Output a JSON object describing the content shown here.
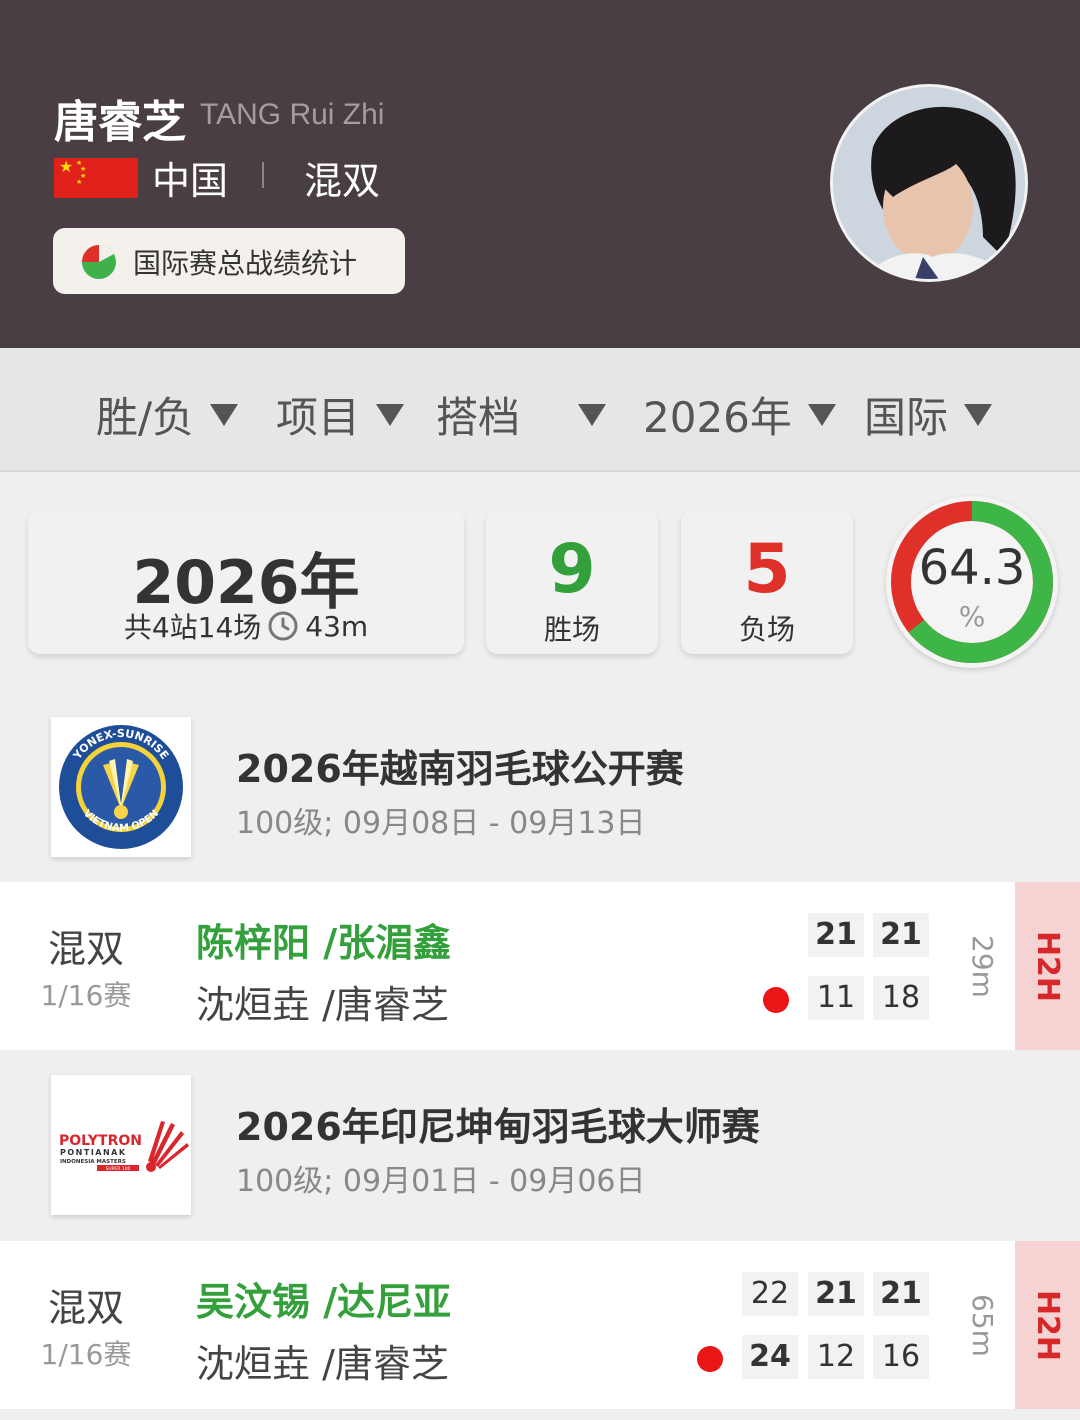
{
  "player": {
    "name_cn": "唐睿芝",
    "name_en": "TANG Rui Zhi",
    "country": "中国",
    "event": "混双",
    "stats_button": "国际赛总战绩统计"
  },
  "filters": [
    {
      "label": "胜/负"
    },
    {
      "label": "项目"
    },
    {
      "label": "搭档"
    },
    {
      "label": "2026年"
    },
    {
      "label": "国际"
    }
  ],
  "summary": {
    "year": "2026年",
    "detail": "共4站14场",
    "duration": "43m",
    "wins": "9",
    "wins_label": "胜场",
    "losses": "5",
    "losses_label": "负场",
    "win_rate": "64.3",
    "win_rate_unit": "%",
    "win_fraction": 0.643
  },
  "tournaments": [
    {
      "name": "2026年越南羽毛球公开赛",
      "info": "100级;  09月08日 - 09月13日",
      "match": {
        "type": "混双",
        "round": "1/16赛",
        "winners": "陈梓阳 /张湄鑫",
        "losers": "沈烜垚 /唐睿芝",
        "winner_scores": [
          "21",
          "21"
        ],
        "loser_scores": [
          "11",
          "18"
        ],
        "duration": "29m",
        "h2h": "H2H"
      }
    },
    {
      "name": "2026年印尼坤甸羽毛球大师赛",
      "info": "100级;  09月01日 - 09月06日",
      "match": {
        "type": "混双",
        "round": "1/16赛",
        "winners": "吴汶锡 /达尼亚",
        "losers": "沈烜垚 /唐睿芝",
        "winner_scores": [
          "22",
          "21",
          "21"
        ],
        "loser_scores": [
          "24",
          "12",
          "16"
        ],
        "duration": "65m",
        "h2h": "H2H"
      }
    }
  ],
  "logos": {
    "vietnam_top": "YONEX-SUNRISE",
    "vietnam_bottom": "VIETNAM OPEN",
    "indo_brand": "POLYTRON",
    "indo_city": "PONTIANAK",
    "indo_event": "INDONESIA MASTERS",
    "indo_tier": "SUPER 100"
  },
  "colors": {
    "header_bg": "#483e43",
    "win_green": "#33a03c",
    "loss_red": "#e0302a",
    "h2h_bg": "#f6d3d3",
    "h2h_text": "#d62828"
  }
}
